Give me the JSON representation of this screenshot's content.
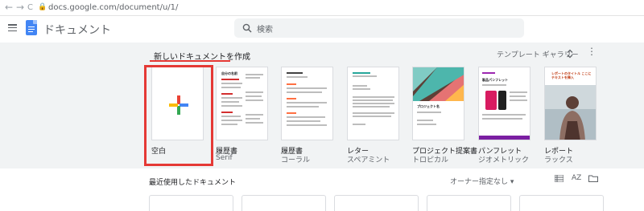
{
  "browser": {
    "back_glyph": "←",
    "forward_glyph": "→",
    "reload_glyph": "C",
    "lock_glyph": "🔒",
    "url": "docs.google.com/document/u/1/"
  },
  "header": {
    "menu_icon": "hamburger-icon",
    "app_icon": "google-docs-icon",
    "app_title": "ドキュメント",
    "search_icon": "search-icon",
    "search_placeholder": "検索"
  },
  "gallery": {
    "title": "新しいドキュメントを作成",
    "toggle_label": "テンプレート ギャラリー",
    "toggle_icon": "unfold-icon",
    "more_icon": "more-vert-icon",
    "templates": [
      {
        "name": "空白",
        "sub": ""
      },
      {
        "name": "履歴書",
        "sub": "Serif",
        "thumb_heading": "自分の名前"
      },
      {
        "name": "履歴書",
        "sub": "コーラル"
      },
      {
        "name": "レター",
        "sub": "スペアミント"
      },
      {
        "name": "プロジェクト提案書",
        "sub": "トロピカル",
        "thumb_heading": "プロジェクト名"
      },
      {
        "name": "パンフレット",
        "sub": "ジオメトリック",
        "thumb_heading": "製品パンフレット"
      },
      {
        "name": "レポート",
        "sub": "ラックス",
        "thumb_heading": "レポートのタイトル ここにテキストを挿入"
      }
    ]
  },
  "recent": {
    "title": "最近使用したドキュメント",
    "owner_filter": "オーナー指定なし ▾",
    "list_icon": "list-view-icon",
    "sort_icon": "sort-az-icon",
    "sort_label": "AZ",
    "folder_icon": "folder-icon"
  },
  "colors": {
    "accent_blue": "#4285f4",
    "highlight_red": "#e53935",
    "gallery_bg": "#f1f3f4"
  }
}
